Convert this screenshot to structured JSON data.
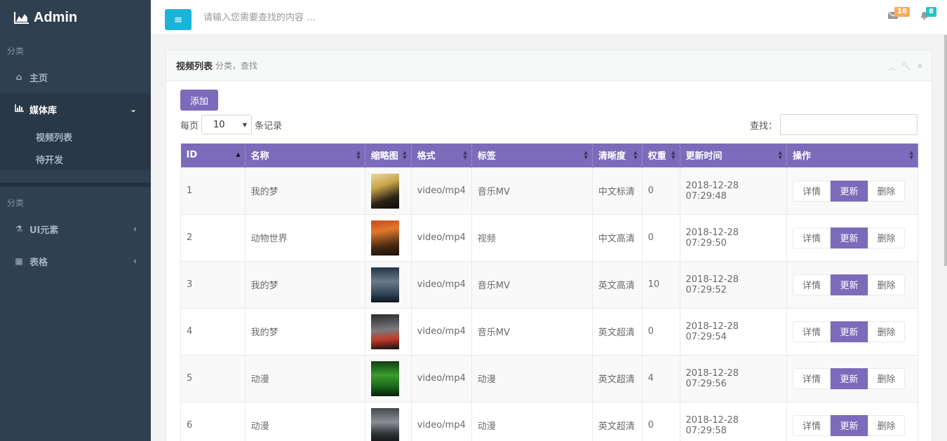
{
  "brand": {
    "title": "Admin"
  },
  "sidebar": {
    "section1": "分类",
    "section2": "分类",
    "items": [
      {
        "label": "主页",
        "icon": "home-icon"
      },
      {
        "label": "媒体库",
        "icon": "bar-chart-icon"
      },
      {
        "label": "UI元素",
        "icon": "flask-icon"
      },
      {
        "label": "表格",
        "icon": "table-icon"
      }
    ],
    "subitems": [
      {
        "label": "视频列表"
      },
      {
        "label": "待开发"
      }
    ]
  },
  "topbar": {
    "search_placeholder": "请输入您需要查找的内容 …",
    "mail_count": "16",
    "bell_count": "8"
  },
  "panel": {
    "title": "视频列表",
    "subtitle": "分类，查找",
    "add_label": "添加",
    "per_page_prefix": "每页",
    "per_page_value": "10",
    "per_page_suffix": "条记录",
    "find_label": "查找："
  },
  "table": {
    "headers": [
      "ID",
      "名称",
      "缩略图",
      "格式",
      "标签",
      "清晰度",
      "权重",
      "更新时间",
      "操作"
    ],
    "actions": {
      "detail": "详情",
      "update": "更新",
      "delete": "删除"
    },
    "rows": [
      {
        "id": "1",
        "name": "我的梦",
        "format": "video/mp4",
        "tag": "音乐MV",
        "quality": "中文标清",
        "weight": "0",
        "time": "2018-12-28 07:29:48"
      },
      {
        "id": "2",
        "name": "动物世界",
        "format": "video/mp4",
        "tag": "视频",
        "quality": "中文高清",
        "weight": "0",
        "time": "2018-12-28 07:29:50"
      },
      {
        "id": "3",
        "name": "我的梦",
        "format": "video/mp4",
        "tag": "音乐MV",
        "quality": "英文高清",
        "weight": "10",
        "time": "2018-12-28 07:29:52"
      },
      {
        "id": "4",
        "name": "我的梦",
        "format": "video/mp4",
        "tag": "音乐MV",
        "quality": "英文超清",
        "weight": "0",
        "time": "2018-12-28 07:29:54"
      },
      {
        "id": "5",
        "name": "动漫",
        "format": "video/mp4",
        "tag": "动漫",
        "quality": "英文超清",
        "weight": "4",
        "time": "2018-12-28 07:29:56"
      },
      {
        "id": "6",
        "name": "动漫",
        "format": "video/mp4",
        "tag": "动漫",
        "quality": "英文超清",
        "weight": "0",
        "time": "2018-12-28 07:29:58"
      }
    ]
  },
  "colors": {
    "sidebar": "#2f4050",
    "accent": "#7b6bba",
    "menu_button": "#1ab3d9"
  }
}
